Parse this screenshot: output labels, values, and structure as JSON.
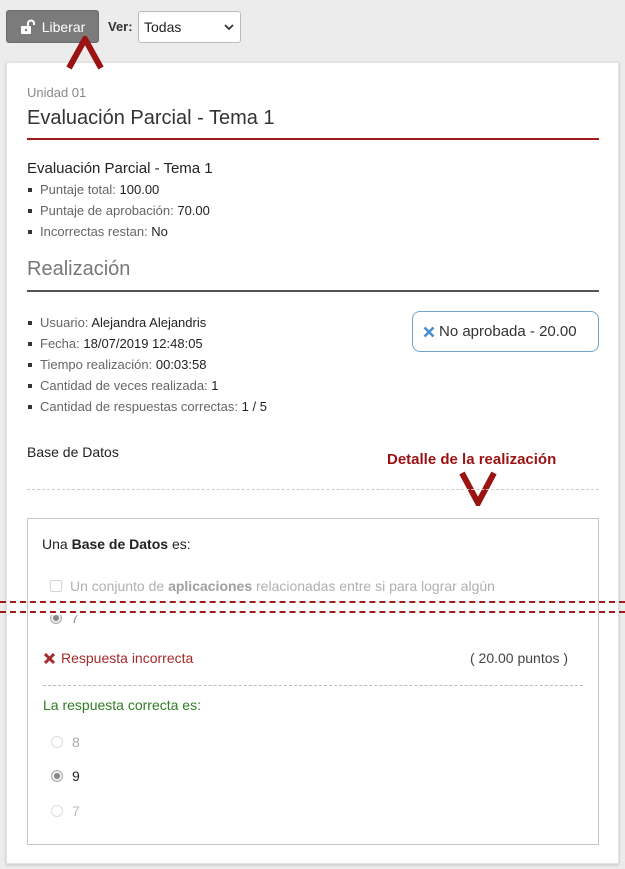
{
  "toolbar": {
    "liberar_label": "Liberar",
    "ver_label": "Ver:",
    "ver_selected": "Todas"
  },
  "annotations": {
    "detail_label": "Detalle de la realización"
  },
  "header": {
    "unit": "Unidad 01",
    "title": "Evaluación Parcial - Tema 1"
  },
  "evaluation": {
    "name": "Evaluación Parcial - Tema 1",
    "items": [
      {
        "label": "Puntaje total:",
        "value": "100.00"
      },
      {
        "label": "Puntaje de aprobación:",
        "value": "70.00"
      },
      {
        "label": "Incorrectas restan:",
        "value": "No"
      }
    ]
  },
  "realization": {
    "title": "Realización",
    "items": [
      {
        "label": "Usuario:",
        "value": "Alejandra Alejandris"
      },
      {
        "label": "Fecha:",
        "value": "18/07/2019 12:48:05"
      },
      {
        "label": "Tiempo realización:",
        "value": "00:03:58"
      },
      {
        "label": "Cantidad de veces realizada:",
        "value": "1"
      },
      {
        "label": "Cantidad de respuestas correctas:",
        "value": "1 / 5"
      }
    ],
    "status": "No aprobada - 20.00"
  },
  "section": {
    "name": "Base de Datos"
  },
  "question": {
    "prefix": "Una ",
    "bold": "Base de Datos",
    "suffix": " es:",
    "option_faded": {
      "prefix": "Un conjunto de ",
      "bold": "aplicaciones",
      "suffix": " relacionadas entre si para lograr algún"
    },
    "option_partial": "7",
    "result": "Respuesta incorrecta",
    "points": "( 20.00 puntos )",
    "correct_label": "La respuesta correcta es:",
    "correct_options": [
      "8",
      "9",
      "7"
    ]
  },
  "colors": {
    "accent_red": "#a31a1a",
    "correct_green": "#2e7d22",
    "badge_border": "#6ea6cc",
    "x_blue": "#4a8ec9"
  }
}
